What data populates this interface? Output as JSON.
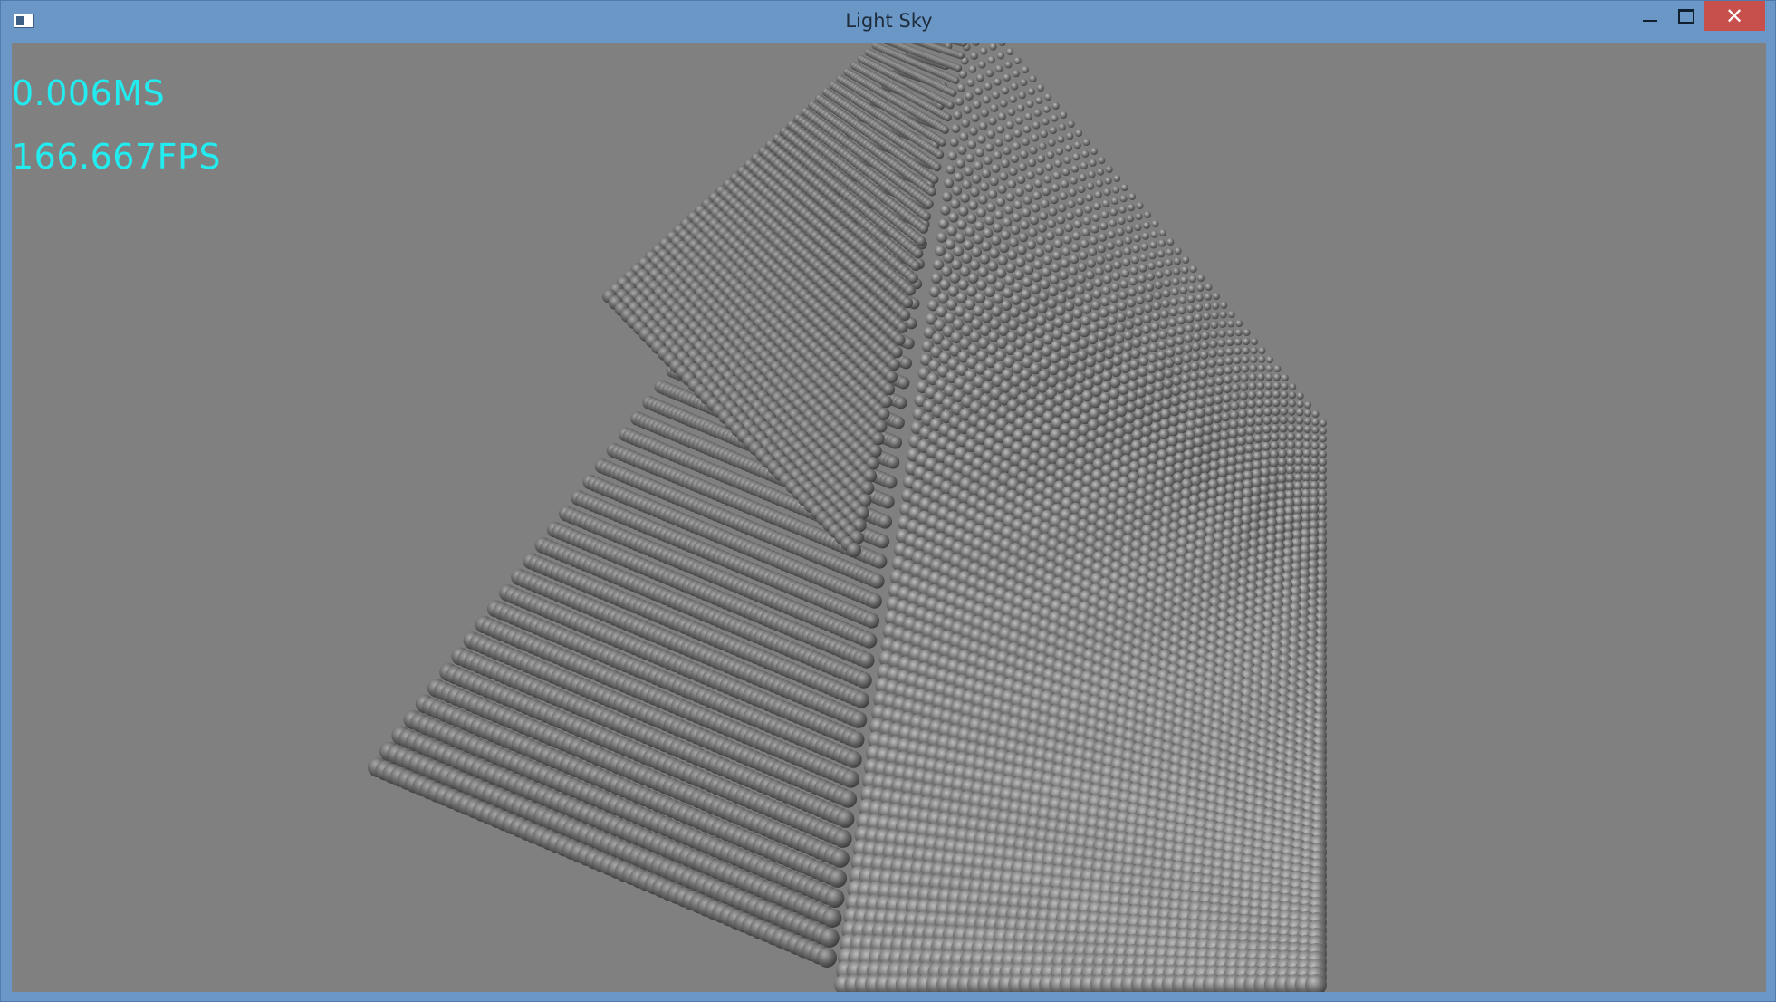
{
  "window": {
    "title": "Light Sky",
    "app_icon": "window-app-icon",
    "controls": {
      "minimize_icon": "minimize-icon",
      "maximize_icon": "maximize-icon",
      "close_icon": "close-icon",
      "close_glyph": "✕"
    },
    "colors": {
      "frame": "#6b97c6",
      "close_button": "#c8504c"
    }
  },
  "viewport": {
    "background": "#808080",
    "hud": {
      "frame_time": "0.006MS",
      "fps": "166.667FPS",
      "color": "#22ecf0"
    },
    "scene": {
      "object": "cube of spheres",
      "sphere_color": "#6e6e6e"
    }
  }
}
